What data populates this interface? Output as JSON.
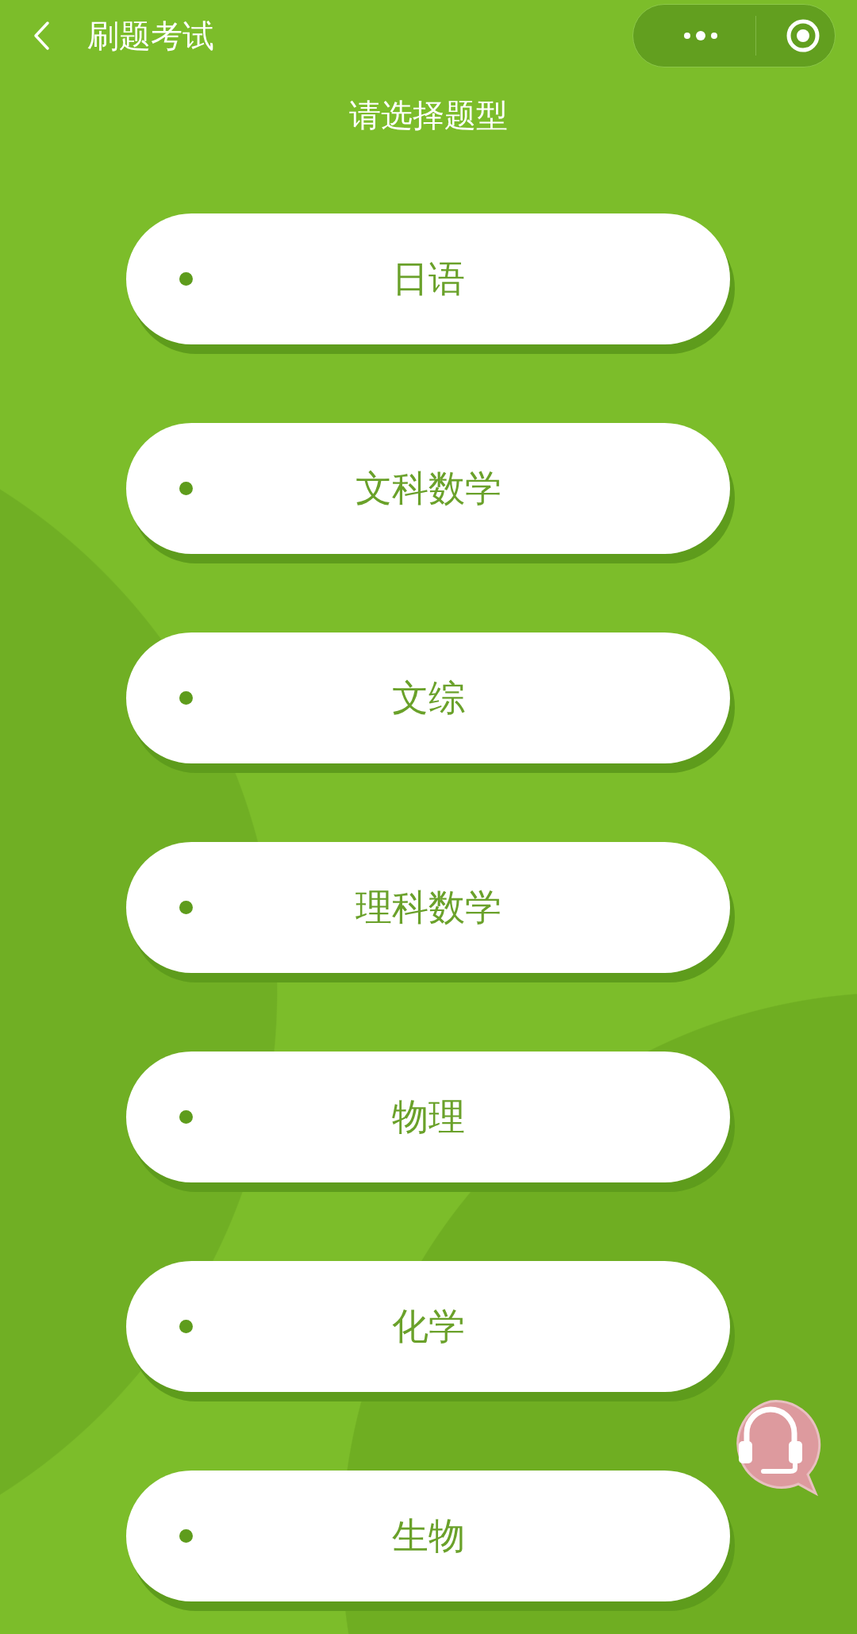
{
  "nav_bar": {
    "title": "刷题考试"
  },
  "heading": "请选择题型",
  "options": [
    {
      "label": "日语"
    },
    {
      "label": "文科数学"
    },
    {
      "label": "文综"
    },
    {
      "label": "理科数学"
    },
    {
      "label": "物理"
    },
    {
      "label": "化学"
    },
    {
      "label": "生物"
    }
  ]
}
